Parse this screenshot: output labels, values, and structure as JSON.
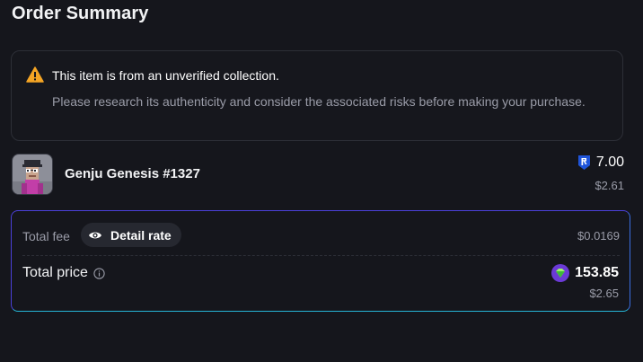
{
  "header": {
    "title": "Order Summary"
  },
  "warning": {
    "icon": "warning-triangle-icon",
    "title": "This item is from an unverified collection.",
    "body": "Please research its authenticity and consider the associated risks before making your purchase."
  },
  "item": {
    "thumbnail_icon": "pixel-avatar-icon",
    "name": "Genju Genesis #1327",
    "price_icon": "ronin-token-icon",
    "price": "7.00",
    "price_usd": "$2.61"
  },
  "summary": {
    "fee_label": "Total fee",
    "detail_label": "Detail rate",
    "detail_icon": "eye-icon",
    "fee_value": "$0.0169",
    "total_label": "Total price",
    "total_info_icon": "info-icon",
    "total_token_icon": "gem-token-icon",
    "total_value": "153.85",
    "total_usd": "$2.65"
  },
  "colors": {
    "background": "#15161c",
    "warning_accent": "#f5a524",
    "border_gradient_start": "#4b40d8",
    "border_gradient_end": "#25b5d6",
    "token_blue": "#1f54d9",
    "muted_text": "#9a9ca8"
  }
}
